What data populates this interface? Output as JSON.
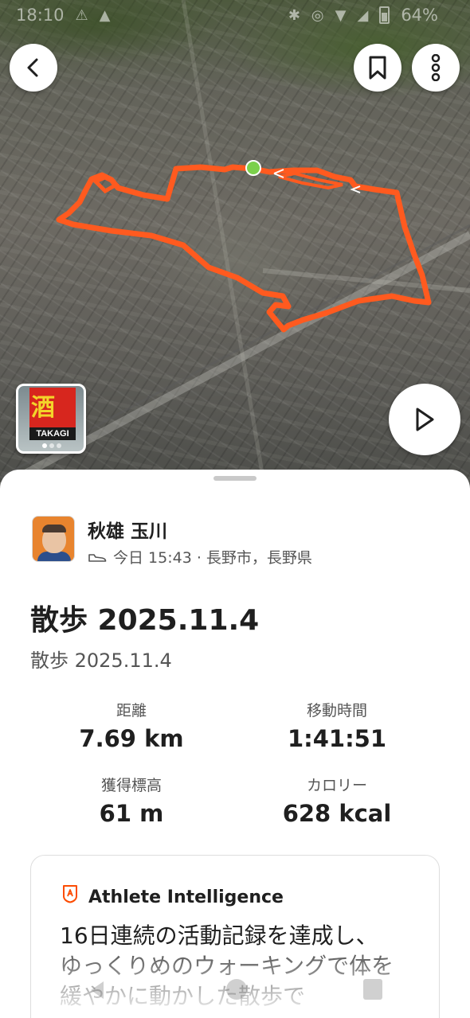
{
  "status_bar": {
    "time": "18:10",
    "battery": "64%"
  },
  "map": {
    "route_color": "#ff5a1f",
    "start_marker_color": "#7bd04b"
  },
  "photo_thumbnail": {
    "sign_char": "酒",
    "sign_text": "TAKAGI"
  },
  "athlete": {
    "name": "秋雄 玉川",
    "activity_icon": "shoe-icon",
    "meta": "今日 15:43 · 長野市，長野県"
  },
  "activity": {
    "title": "散歩 2025.11.4",
    "subtitle": "散歩 2025.11.4"
  },
  "stats": [
    {
      "label": "距離",
      "value": "7.69 km"
    },
    {
      "label": "移動時間",
      "value": "1:41:51"
    },
    {
      "label": "獲得標高",
      "value": "61 m"
    },
    {
      "label": "カロリー",
      "value": "628 kcal"
    }
  ],
  "athlete_intelligence": {
    "title": "Athlete Intelligence",
    "text": "16日連続の活動記録を達成し、ゆっくりめのウォーキングで体を緩やかに動かした散歩で"
  },
  "colors": {
    "accent": "#fc4c02",
    "text_primary": "#1f1f1f",
    "text_secondary": "#555555"
  }
}
